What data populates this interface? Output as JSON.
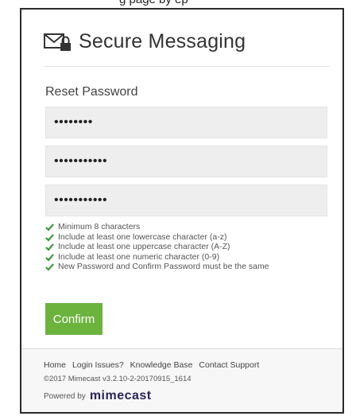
{
  "top_caption": "g page          by  ep",
  "header": {
    "title": "Secure Messaging",
    "icon": "envelope-lock-icon"
  },
  "form": {
    "section_title": "Reset Password",
    "fields": [
      {
        "value": "••••••••"
      },
      {
        "value": "•••••••••••"
      },
      {
        "value": "•••••••••••"
      }
    ],
    "rules": [
      "Minimum 8 characters",
      "Include at least one lowercase character (a-z)",
      "Include at least one uppercase character (A-Z)",
      "Include at least one numeric character (0-9)",
      "New Password and Confirm Password must be the same"
    ],
    "confirm_label": "Confirm"
  },
  "footer": {
    "links": [
      "Home",
      "Login Issues?",
      "Knowledge Base",
      "Contact Support"
    ],
    "copyright": "©2017 Mimecast v3.2.10-2-20170915_1614",
    "powered_by": "Powered by",
    "brand": "mimecast"
  },
  "colors": {
    "accent": "#6cb33e",
    "check": "#3a9a3a",
    "brand": "#2a2556"
  }
}
